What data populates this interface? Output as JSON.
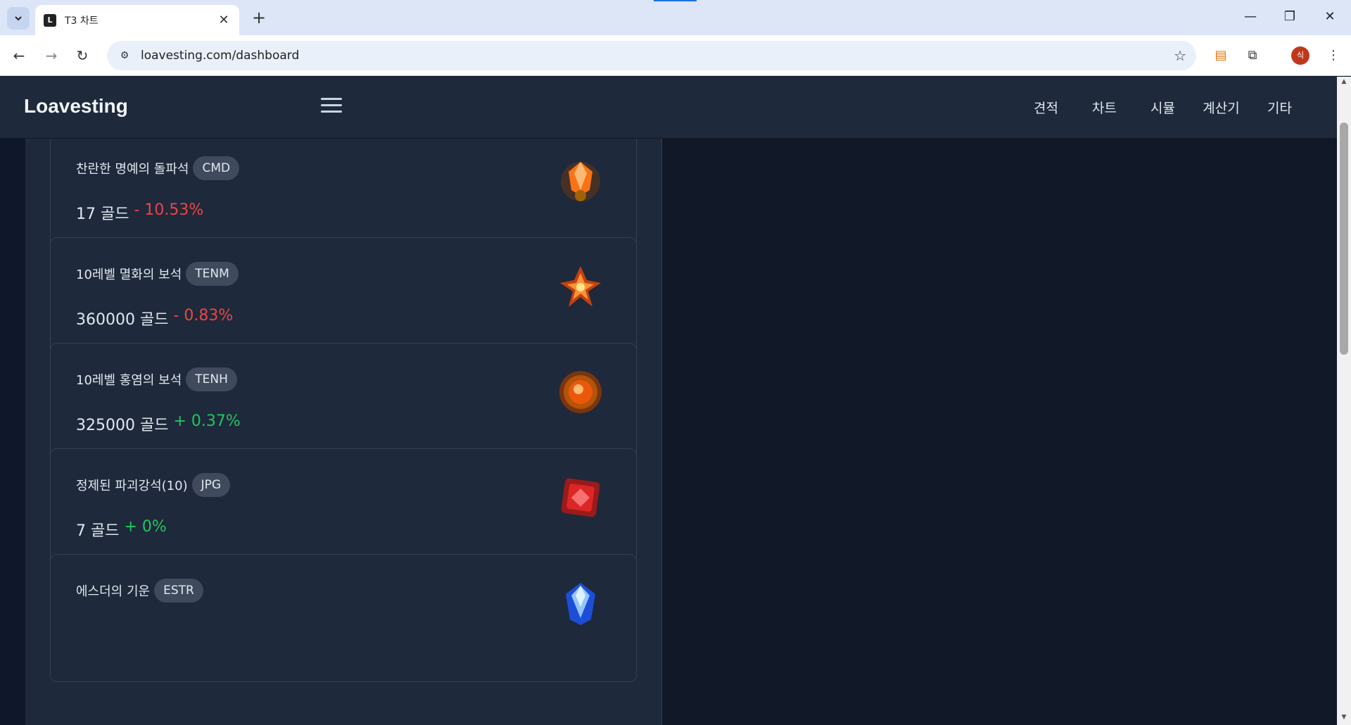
{
  "browser": {
    "tab_title": "T3 차트",
    "favicon_letter": "L",
    "url": "loavesting.com/dashboard",
    "profile_initial": "식"
  },
  "site": {
    "logo": "Loavesting",
    "nav": [
      "견적",
      "차트",
      "시뮬",
      "계산기",
      "기타"
    ]
  },
  "items": [
    {
      "name": "찬란한 명예의 돌파석",
      "code": "CMD",
      "price": "17 골드",
      "change": "- 10.53%",
      "direction": "down",
      "icon": "orange-crystal-icon"
    },
    {
      "name": "10레벨 멸화의 보석",
      "code": "TENM",
      "price": "360000 골드",
      "change": "- 0.83%",
      "direction": "down",
      "icon": "fire-gem-icon"
    },
    {
      "name": "10레벨 홍염의 보석",
      "code": "TENH",
      "price": "325000 골드",
      "change": "+ 0.37%",
      "direction": "up",
      "icon": "flame-gem-icon"
    },
    {
      "name": "정제된 파괴강석(10)",
      "code": "JPG",
      "price": "7 골드",
      "change": "+ 0%",
      "direction": "up",
      "icon": "red-stone-icon"
    },
    {
      "name": "에스더의 기운",
      "code": "ESTR",
      "price": "",
      "change": "",
      "direction": "",
      "icon": "blue-crystal-icon"
    }
  ],
  "colors": {
    "negative": "#ef4444",
    "positive": "#22c55e",
    "panel": "#1e293b",
    "background": "#0f172a"
  }
}
